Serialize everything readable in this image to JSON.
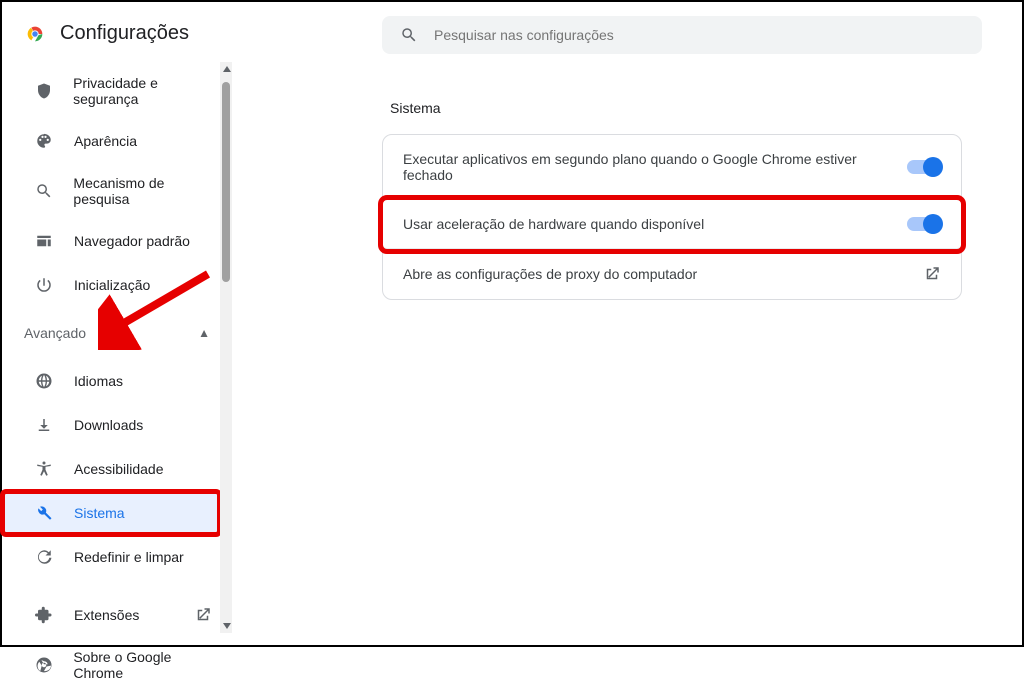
{
  "header": {
    "title": "Configurações"
  },
  "search": {
    "placeholder": "Pesquisar nas configurações"
  },
  "sidebar": {
    "top_items": [
      {
        "id": "privacy",
        "label": "Privacidade e segurança",
        "icon": "shield-icon"
      },
      {
        "id": "appearance",
        "label": "Aparência",
        "icon": "palette-icon"
      },
      {
        "id": "search-e",
        "label": "Mecanismo de pesquisa",
        "icon": "search-icon"
      },
      {
        "id": "default-b",
        "label": "Navegador padrão",
        "icon": "browser-icon"
      },
      {
        "id": "startup",
        "label": "Inicialização",
        "icon": "power-icon"
      }
    ],
    "advanced_label": "Avançado",
    "advanced_items": [
      {
        "id": "languages",
        "label": "Idiomas",
        "icon": "globe-icon"
      },
      {
        "id": "downloads",
        "label": "Downloads",
        "icon": "download-icon"
      },
      {
        "id": "a11y",
        "label": "Acessibilidade",
        "icon": "accessibility-icon"
      },
      {
        "id": "system",
        "label": "Sistema",
        "icon": "wrench-icon",
        "selected": true
      },
      {
        "id": "reset",
        "label": "Redefinir e limpar",
        "icon": "restore-icon"
      }
    ],
    "footer_items": [
      {
        "id": "extensions",
        "label": "Extensões",
        "icon": "extension-icon",
        "external": true
      },
      {
        "id": "about",
        "label": "Sobre o Google Chrome",
        "icon": "chrome-mono-icon"
      }
    ]
  },
  "main": {
    "section_title": "Sistema",
    "rows": [
      {
        "id": "bg-apps",
        "label": "Executar aplicativos em segundo plano quando o Google Chrome estiver fechado",
        "toggle": true
      },
      {
        "id": "hw-accel",
        "label": "Usar aceleração de hardware quando disponível",
        "toggle": true,
        "highlighted": true
      },
      {
        "id": "proxy",
        "label": "Abre as configurações de proxy do computador",
        "launch": true
      }
    ]
  }
}
